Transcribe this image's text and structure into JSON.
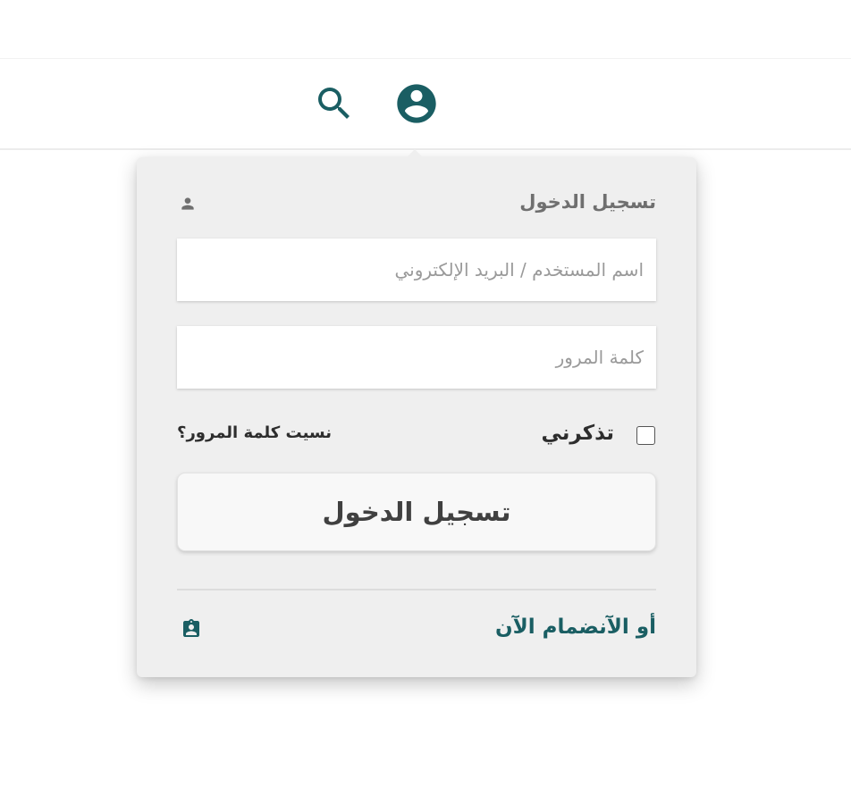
{
  "colors": {
    "accent": "#1a5e63",
    "panel_bg": "#efefef",
    "muted_text": "#6f6f6f",
    "dark_text": "#2d2d2d"
  },
  "header": {
    "icons": [
      "search-icon",
      "account-circle-icon"
    ]
  },
  "login_dropdown": {
    "title": "تسجيل الدخول",
    "title_icon": "person-icon",
    "username_field": {
      "placeholder": "اسم المستخدم / البريد الإلكتروني",
      "value": ""
    },
    "password_field": {
      "placeholder": "كلمة المرور",
      "value": ""
    },
    "remember_me_label": "تذكرني",
    "remember_me_checked": false,
    "forgot_password_label": "نسيت كلمة المرور؟",
    "submit_label": "تسجيل الدخول",
    "join_label": "أو الآنضمام الآن",
    "join_icon": "contact-badge-icon"
  }
}
